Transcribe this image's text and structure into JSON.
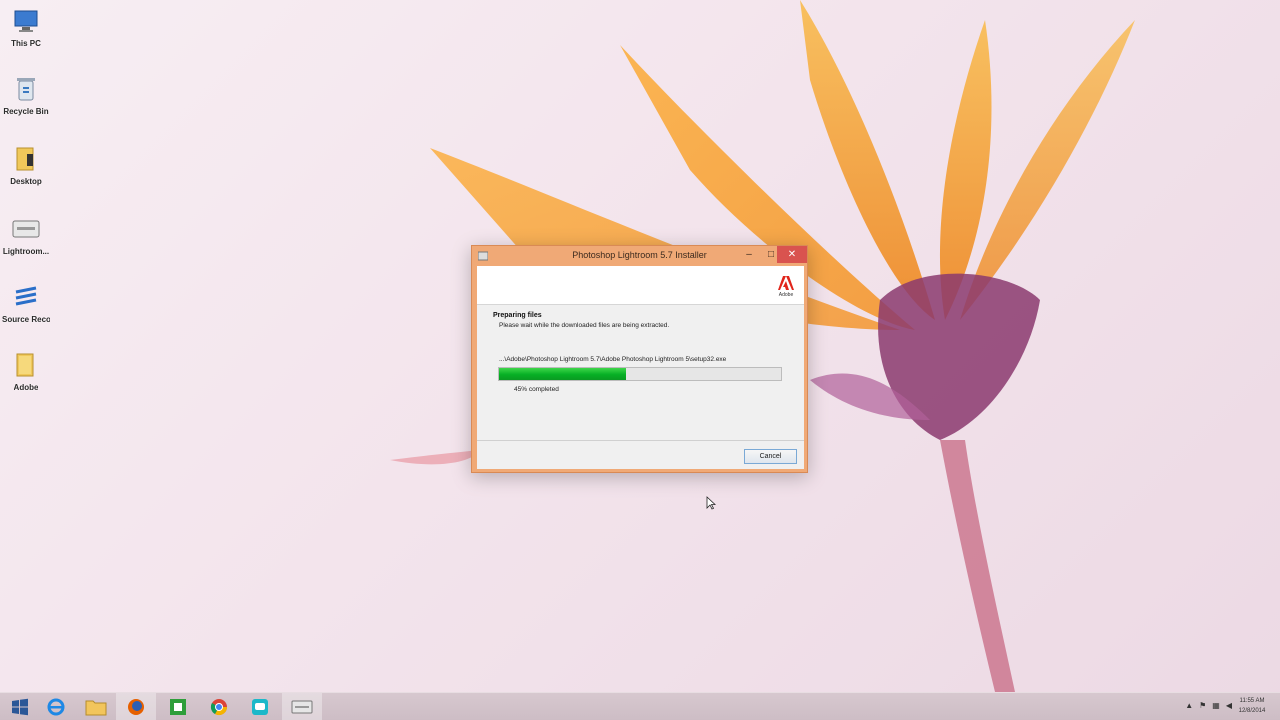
{
  "desktop": {
    "icons": [
      {
        "label": "This PC",
        "icon": "computer-icon"
      },
      {
        "label": "Recycle Bin",
        "icon": "recycle-bin-icon"
      },
      {
        "label": "Desktop",
        "icon": "folder-icon"
      },
      {
        "label": "Lightroom...",
        "icon": "installer-icon"
      },
      {
        "label": "Source Recorder",
        "icon": "app-icon"
      },
      {
        "label": "Adobe",
        "icon": "folder-icon"
      }
    ]
  },
  "installer": {
    "title": "Photoshop Lightroom 5.7 Installer",
    "minimize": "–",
    "maximize": "□",
    "close": "✕",
    "brand": "Adobe",
    "section_title": "Preparing files",
    "section_desc": "Please wait while the downloaded files are being extracted.",
    "file_path": "...\\Adobe\\Photoshop Lightroom 5.7\\Adobe Photoshop Lightroom 5\\setup32.exe",
    "progress_percent": 45,
    "progress_label": "45% completed",
    "cancel_label": "Cancel",
    "accent_color": "#f0a976"
  },
  "taskbar": {
    "buttons": [
      {
        "name": "start",
        "icon": "windows-icon"
      },
      {
        "name": "internet-explorer",
        "icon": "ie-icon"
      },
      {
        "name": "file-explorer",
        "icon": "folder-icon"
      },
      {
        "name": "firefox",
        "icon": "firefox-icon"
      },
      {
        "name": "app-green",
        "icon": "green-app-icon"
      },
      {
        "name": "chrome",
        "icon": "chrome-icon"
      },
      {
        "name": "app-cyan",
        "icon": "cyan-app-icon"
      },
      {
        "name": "installer",
        "icon": "installer-icon"
      }
    ],
    "clock_time": "11:55 AM",
    "clock_date": "12/8/2014"
  }
}
